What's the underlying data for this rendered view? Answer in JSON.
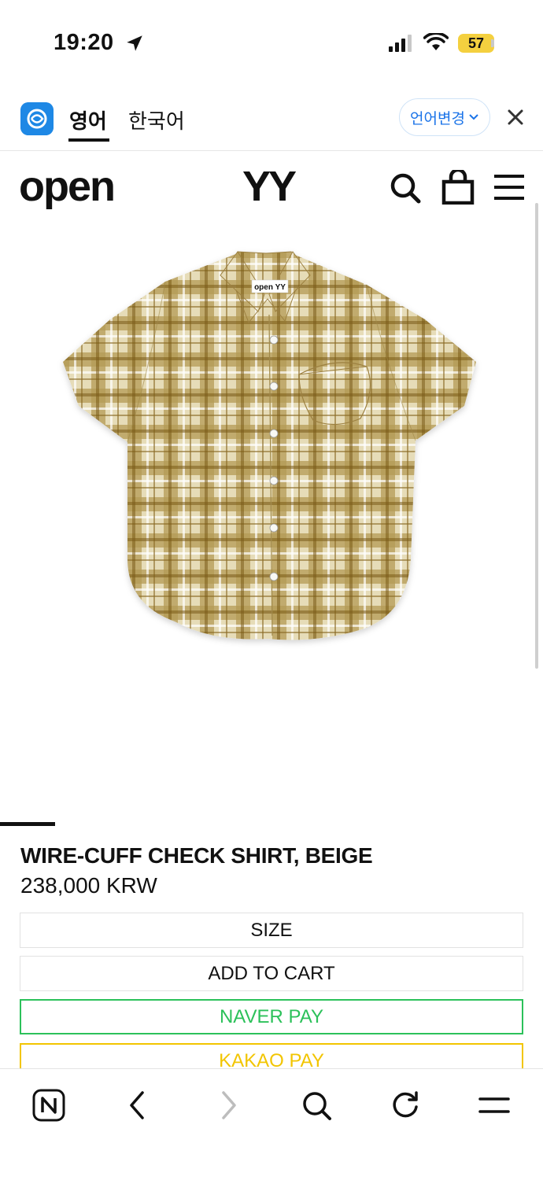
{
  "status_bar": {
    "time": "19:20",
    "battery": "57",
    "icons": [
      "location-arrow-icon",
      "cellular-signal-icon",
      "wifi-icon",
      "battery-icon"
    ]
  },
  "translate_bar": {
    "tab_english": "영어",
    "tab_korean": "한국어",
    "change_language": "언어변경",
    "accent_color": "#1a73e8"
  },
  "site": {
    "brand_left": "open",
    "brand_right": "YY"
  },
  "product": {
    "title": "WIRE-CUFF CHECK SHIRT, BEIGE",
    "price": "238,000 KRW",
    "buttons": {
      "size": "SIZE",
      "add_to_cart": "ADD TO CART",
      "naver_pay": "NAVER PAY",
      "kakao_pay": "KAKAO PAY"
    },
    "label_text": "open YY",
    "colors": {
      "naver": "#2cc15a",
      "kakao": "#f2c500"
    }
  },
  "toolbar": {
    "icons": [
      "naver-n-icon",
      "back-icon",
      "forward-icon",
      "search-icon",
      "reload-icon",
      "menu-icon"
    ]
  }
}
